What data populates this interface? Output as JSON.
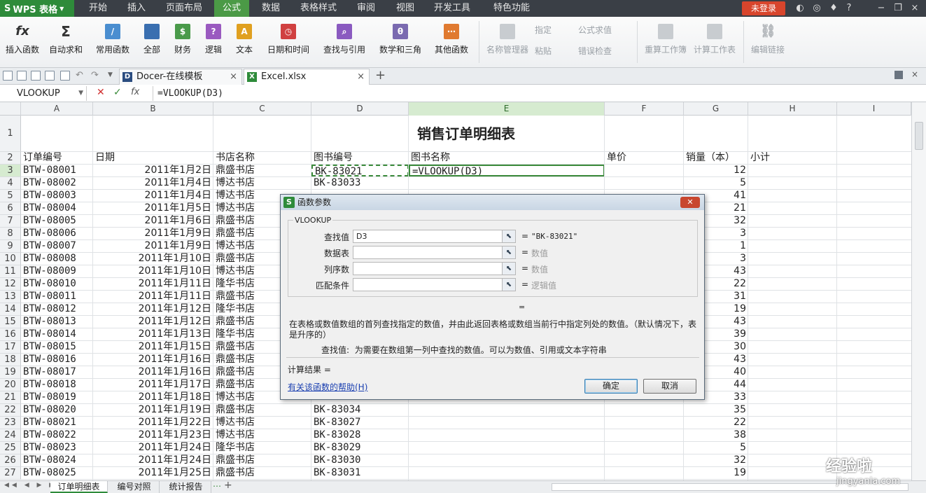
{
  "app": {
    "name": "WPS 表格"
  },
  "menu": {
    "tabs": [
      "开始",
      "插入",
      "页面布局",
      "公式",
      "数据",
      "表格样式",
      "审阅",
      "视图",
      "开发工具",
      "特色功能"
    ],
    "active_index": 3,
    "login": "未登录"
  },
  "ribbon": {
    "buttons": [
      "插入函数",
      "自动求和",
      "常用函数",
      "全部",
      "财务",
      "逻辑",
      "文本",
      "日期和时间",
      "查找与引用",
      "数学和三角",
      "其他函数"
    ],
    "disabled": [
      "名称管理器",
      "重算工作簿",
      "计算工作表",
      "编辑链接"
    ],
    "small": [
      "指定",
      "粘贴",
      "公式求值",
      "错误检查"
    ]
  },
  "tabs": {
    "doc1": "Docer-在线模板",
    "doc2": "Excel.xlsx"
  },
  "formula_bar": {
    "name_box": "VLOOKUP",
    "formula": "=VLOOKUP(D3)",
    "fx": "fx"
  },
  "columns": [
    "A",
    "B",
    "C",
    "D",
    "E",
    "F",
    "G",
    "H",
    "I"
  ],
  "sheet": {
    "title": "销售订单明细表",
    "headers": [
      "订单编号",
      "日期",
      "书店名称",
      "图书编号",
      "图书名称",
      "单价",
      "销量（本）",
      "小计"
    ],
    "row_numbers": [
      "1",
      "2",
      "3",
      "4",
      "5",
      "6",
      "7",
      "8",
      "9",
      "10",
      "11",
      "12",
      "13",
      "14",
      "15",
      "16",
      "17",
      "18",
      "19",
      "20",
      "21",
      "22",
      "23",
      "24",
      "25",
      "26",
      "27"
    ],
    "rows": [
      [
        "BTW-08001",
        "2011年1月2日",
        "鼎盛书店",
        "BK-83021",
        "=VLOOKUP(D3)",
        "",
        "12"
      ],
      [
        "BTW-08002",
        "2011年1月4日",
        "博达书店",
        "BK-83033",
        "",
        "",
        "5"
      ],
      [
        "BTW-08003",
        "2011年1月4日",
        "博达书店",
        "",
        "",
        "",
        "41"
      ],
      [
        "BTW-08004",
        "2011年1月5日",
        "博达书店",
        "",
        "",
        "",
        "21"
      ],
      [
        "BTW-08005",
        "2011年1月6日",
        "鼎盛书店",
        "",
        "",
        "",
        "32"
      ],
      [
        "BTW-08006",
        "2011年1月9日",
        "鼎盛书店",
        "",
        "",
        "",
        "3"
      ],
      [
        "BTW-08007",
        "2011年1月9日",
        "博达书店",
        "",
        "",
        "",
        "1"
      ],
      [
        "BTW-08008",
        "2011年1月10日",
        "鼎盛书店",
        "",
        "",
        "",
        "3"
      ],
      [
        "BTW-08009",
        "2011年1月10日",
        "博达书店",
        "",
        "",
        "",
        "43"
      ],
      [
        "BTW-08010",
        "2011年1月11日",
        "隆华书店",
        "",
        "",
        "",
        "22"
      ],
      [
        "BTW-08011",
        "2011年1月11日",
        "鼎盛书店",
        "",
        "",
        "",
        "31"
      ],
      [
        "BTW-08012",
        "2011年1月12日",
        "隆华书店",
        "",
        "",
        "",
        "19"
      ],
      [
        "BTW-08013",
        "2011年1月12日",
        "鼎盛书店",
        "",
        "",
        "",
        "43"
      ],
      [
        "BTW-08014",
        "2011年1月13日",
        "隆华书店",
        "",
        "",
        "",
        "39"
      ],
      [
        "BTW-08015",
        "2011年1月15日",
        "鼎盛书店",
        "",
        "",
        "",
        "30"
      ],
      [
        "BTW-08016",
        "2011年1月16日",
        "鼎盛书店",
        "",
        "",
        "",
        "43"
      ],
      [
        "BTW-08017",
        "2011年1月16日",
        "鼎盛书店",
        "",
        "",
        "",
        "40"
      ],
      [
        "BTW-08018",
        "2011年1月17日",
        "鼎盛书店",
        "",
        "",
        "",
        "44"
      ],
      [
        "BTW-08019",
        "2011年1月18日",
        "博达书店",
        "",
        "",
        "",
        "33"
      ],
      [
        "BTW-08020",
        "2011年1月19日",
        "鼎盛书店",
        "BK-83034",
        "",
        "",
        "35"
      ],
      [
        "BTW-08021",
        "2011年1月22日",
        "博达书店",
        "BK-83027",
        "",
        "",
        "22"
      ],
      [
        "BTW-08022",
        "2011年1月23日",
        "博达书店",
        "BK-83028",
        "",
        "",
        "38"
      ],
      [
        "BTW-08023",
        "2011年1月24日",
        "隆华书店",
        "BK-83029",
        "",
        "",
        "5"
      ],
      [
        "BTW-08024",
        "2011年1月24日",
        "鼎盛书店",
        "BK-83030",
        "",
        "",
        "32"
      ],
      [
        "BTW-08025",
        "2011年1月25日",
        "鼎盛书店",
        "BK-83031",
        "",
        "",
        "19"
      ]
    ]
  },
  "sheet_tabs": [
    "订单明细表",
    "编号对照",
    "统计报告"
  ],
  "dialog": {
    "title": "函数参数",
    "function": "VLOOKUP",
    "args": [
      {
        "label": "查找值",
        "value": "D3",
        "hint": "\"BK-83021\""
      },
      {
        "label": "数据表",
        "value": "",
        "hint": "数值"
      },
      {
        "label": "列序数",
        "value": "",
        "hint": "数值"
      },
      {
        "label": "匹配条件",
        "value": "",
        "hint": "逻辑值"
      }
    ],
    "eq": "=",
    "description": "在表格或数值数组的首列查找指定的数值，并由此返回表格或数组当前行中指定列处的数值。（默认情况下，表是升序的）",
    "arg_desc_label": "查找值:",
    "arg_desc": "为需要在数组第一列中查找的数值。可以为数值、引用或文本字符串",
    "result": "计算结果 =",
    "help": "有关该函数的帮助(H)",
    "ok": "确定",
    "cancel": "取消"
  },
  "watermark": {
    "line1": "经验啦",
    "line2": "jingyanla.com"
  },
  "colors": {
    "accent": "#2e8b3a",
    "active_col": "#d6ebd0",
    "login": "#d8452c"
  }
}
